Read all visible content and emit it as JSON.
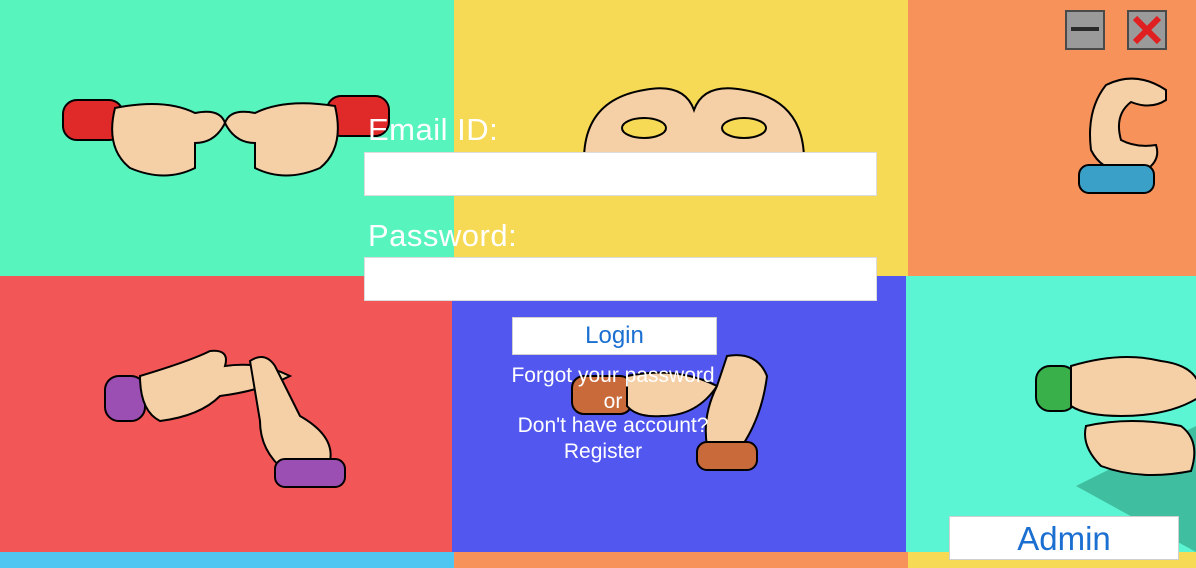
{
  "window": {
    "minimize_icon": "minimize-icon",
    "close_icon": "close-icon"
  },
  "form": {
    "email_label": "Email ID:",
    "email_value": "",
    "password_label": "Password:",
    "password_value": "",
    "login_label": "Login",
    "forgot_label": "Forgot your password",
    "or_label": "or",
    "no_account_label": "Don't have account?",
    "register_label": "Register"
  },
  "admin": {
    "label": "Admin"
  },
  "colors": {
    "tile_green": "#58f4be",
    "tile_yellow": "#f6d955",
    "tile_orange": "#f7925a",
    "tile_red": "#f35656",
    "tile_blue": "#5257f0",
    "tile_mint": "#5cf5d3",
    "accent_text": "#1a6fd1",
    "close_red": "#e02020"
  }
}
